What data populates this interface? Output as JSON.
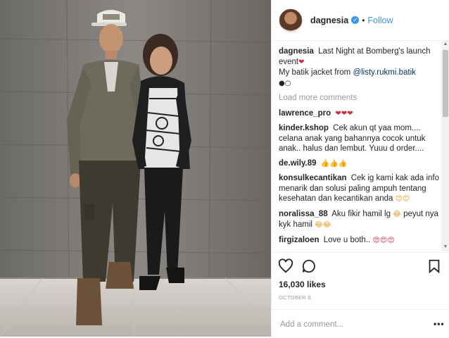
{
  "post": {
    "username": "dagnesia",
    "follow_label": "Follow",
    "separator": "•",
    "verified_glyph": "✓"
  },
  "caption": {
    "user": "dagnesia",
    "text_part1": "Last Night at Bomberg's launch event",
    "heart": "❤",
    "text_part2": "My batik jacket from ",
    "mention": "@listy.rukmi.batik",
    "dots": "●○"
  },
  "load_more_label": "Load more comments",
  "comments": [
    {
      "user": "lawrence_pro",
      "text": "",
      "emoji": "❤❤❤"
    },
    {
      "user": "kinder.kshop",
      "text": "Cek akun qt yaa mom.... celana anak yang bahannya cocok untuk anak.. halus dan lembut. Yuuu d order....",
      "emoji": ""
    },
    {
      "user": "de.wily.89",
      "text": "",
      "emoji": "👍👍👍"
    },
    {
      "user": "konsulkecantikan",
      "text": "Cek ig kami kak ada info menarik dan solusi paling ampuh tentang kesehatan dan kecantikan anda",
      "emoji": "😊😊"
    },
    {
      "user": "noralissa_88",
      "text": "Aku fikir hamil lg",
      "emoji": "😂",
      "text2": "peyut nya kyk hamil",
      "emoji2": "😂😂"
    },
    {
      "user": "firgizaloen",
      "text": "Love u both..",
      "emoji": "😍😍😍"
    }
  ],
  "likes_text": "16,030 likes",
  "date_text": "OCTOBER 6",
  "add_comment_placeholder": "Add a comment...",
  "more_glyph": "•••",
  "icons": {
    "like": "heart-outline-icon",
    "comment": "speech-bubble-icon",
    "save": "bookmark-icon",
    "options": "more-options-icon"
  },
  "colors": {
    "link": "#003569",
    "follow": "#3897f0",
    "muted": "#999999"
  }
}
